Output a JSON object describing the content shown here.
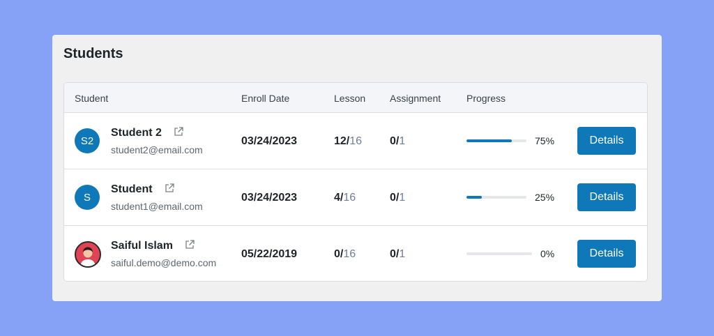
{
  "card": {
    "title": "Students"
  },
  "columns": {
    "student": "Student",
    "enroll_date": "Enroll Date",
    "lesson": "Lesson",
    "assignment": "Assignment",
    "progress": "Progress"
  },
  "students": [
    {
      "initials": "S2",
      "name": "Student 2",
      "email": "student2@email.com",
      "enroll_date": "03/24/2023",
      "lesson_done": "12/",
      "lesson_total": "16",
      "assignment_done": "0/",
      "assignment_total": "1",
      "progress_percent": 75,
      "progress_label": "75%",
      "details_label": "Details"
    },
    {
      "initials": "S",
      "name": "Student",
      "email": "student1@email.com",
      "enroll_date": "03/24/2023",
      "lesson_done": "4/",
      "lesson_total": "16",
      "assignment_done": "0/",
      "assignment_total": "1",
      "progress_percent": 25,
      "progress_label": "25%",
      "details_label": "Details"
    },
    {
      "initials": "",
      "name": "Saiful Islam",
      "email": "saiful.demo@demo.com",
      "enroll_date": "05/22/2019",
      "lesson_done": "0/",
      "lesson_total": "16",
      "assignment_done": "0/",
      "assignment_total": "1",
      "progress_percent": 0,
      "progress_label": "0%",
      "details_label": "Details"
    }
  ],
  "colors": {
    "background": "#86a2f7",
    "card": "#f0f0f1",
    "accent": "#0f78b8",
    "muted_total": "#6e7e96"
  },
  "icons": {
    "external_link": "external-link-icon",
    "user_avatar": "user-avatar-icon"
  }
}
